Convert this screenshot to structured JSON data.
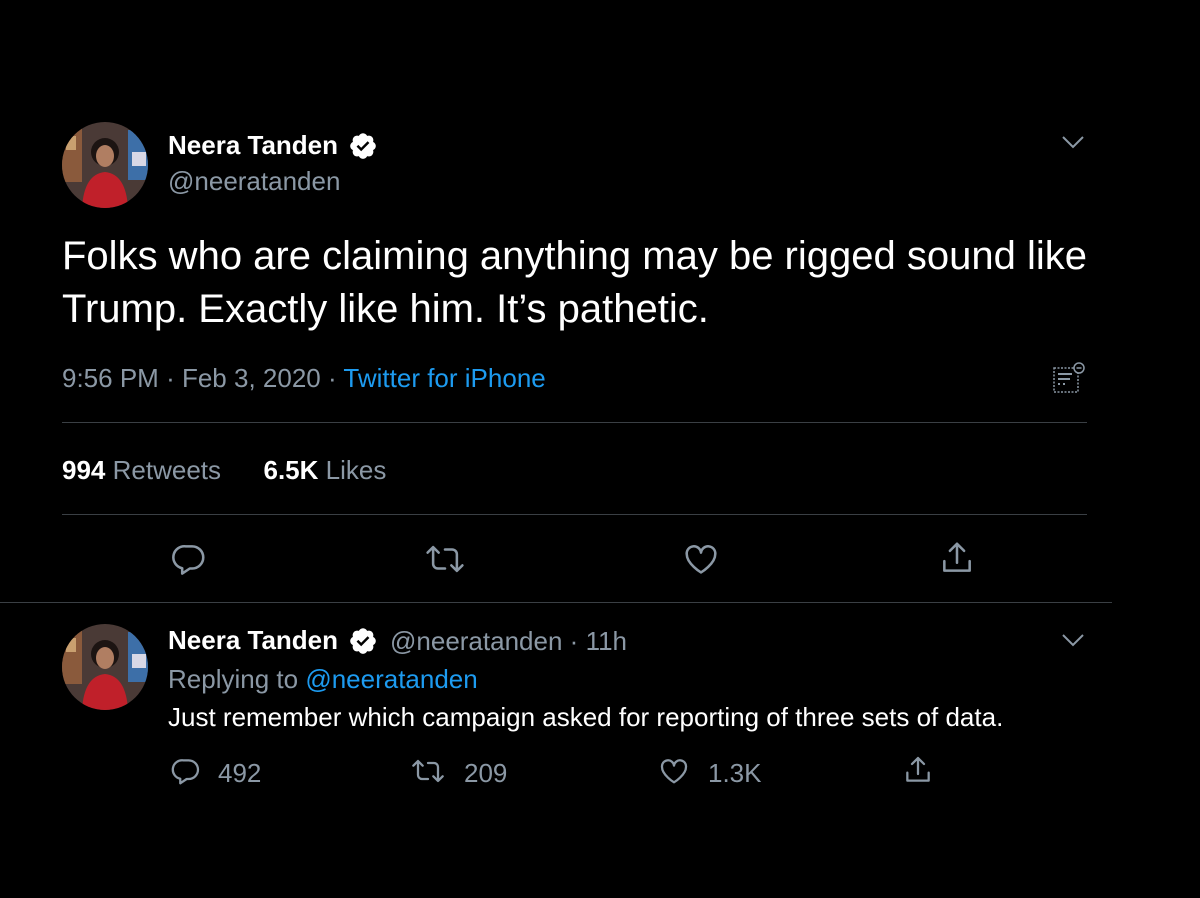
{
  "tweet": {
    "author_name": "Neera Tanden",
    "author_handle": "@neeratanden",
    "text": "Folks who are claiming anything may be rigged sound like Trump. Exactly like him. It’s pathetic.",
    "time": "9:56 PM",
    "separator": "·",
    "date": "Feb 3, 2020",
    "source": "Twitter for iPhone",
    "retweets_count": "994",
    "retweets_label": "Retweets",
    "likes_count": "6.5K",
    "likes_label": "Likes"
  },
  "reply_tweet": {
    "author_name": "Neera Tanden",
    "author_handle": "@neeratanden",
    "separator": "·",
    "age": "11h",
    "replying_prefix": "Replying to",
    "replying_handle": "@neeratanden",
    "text": "Just remember which campaign asked for reporting of three sets of data.",
    "reply_count": "492",
    "retweet_count": "209",
    "like_count": "1.3K"
  },
  "colors": {
    "background": "#000000",
    "text": "#ffffff",
    "secondary": "#8b98a5",
    "link": "#1d9bf0"
  },
  "icons": {
    "verified": "verified-badge-icon",
    "more": "chevron-down-icon",
    "analytics": "analytics-icon",
    "reply": "reply-icon",
    "retweet": "retweet-icon",
    "like": "heart-icon",
    "share": "share-icon"
  }
}
